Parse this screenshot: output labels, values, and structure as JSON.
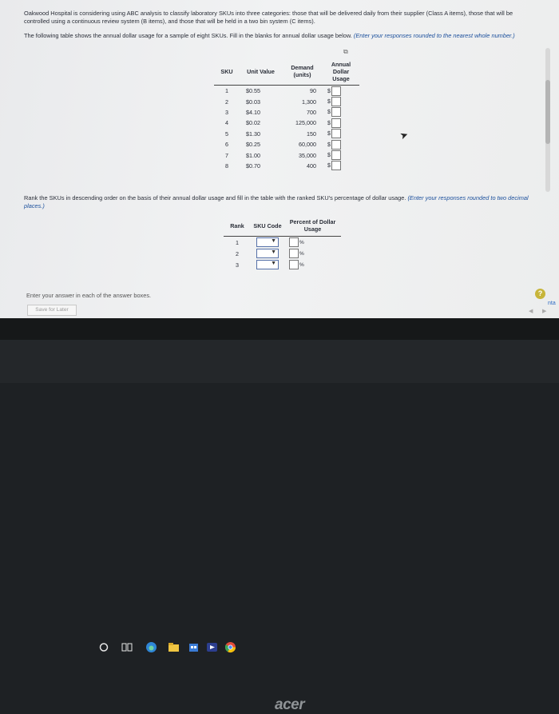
{
  "question": {
    "paragraph1": "Oakwood Hospital is considering using ABC analysis to classify laboratory SKUs into three categories: those that will be delivered daily from their supplier (Class A items), those that will be controlled using a continuous review system (B items), and those that will be held in a two bin system (C items).",
    "paragraph2_main": "The following table shows the annual dollar usage for a sample of eight SKUs. Fill in the blanks for annual dollar usage below.",
    "paragraph2_hint": "(Enter your responses rounded to the nearest whole number.)",
    "paragraph3_main": "Rank the SKUs in descending order on the basis of their annual dollar usage and fill in the table with the ranked SKU's percentage of dollar usage.",
    "paragraph3_hint": "(Enter your responses rounded to two decimal places.)"
  },
  "sku_table": {
    "headers": {
      "sku": "SKU",
      "unit_value": "Unit Value",
      "demand": "Demand (units)",
      "usage": "Annual Dollar Usage"
    },
    "currency": "$",
    "rows": [
      {
        "sku": "1",
        "unit_value": "$0.55",
        "demand": "90"
      },
      {
        "sku": "2",
        "unit_value": "$0.03",
        "demand": "1,300"
      },
      {
        "sku": "3",
        "unit_value": "$4.10",
        "demand": "700"
      },
      {
        "sku": "4",
        "unit_value": "$0.02",
        "demand": "125,000"
      },
      {
        "sku": "5",
        "unit_value": "$1.30",
        "demand": "150"
      },
      {
        "sku": "6",
        "unit_value": "$0.25",
        "demand": "60,000"
      },
      {
        "sku": "7",
        "unit_value": "$1.00",
        "demand": "35,000"
      },
      {
        "sku": "8",
        "unit_value": "$0.70",
        "demand": "400"
      }
    ]
  },
  "rank_table": {
    "headers": {
      "rank": "Rank",
      "sku_code": "SKU Code",
      "percent": "Percent of Dollar Usage"
    },
    "percent_sign": "%",
    "rows": [
      {
        "rank": "1"
      },
      {
        "rank": "2"
      },
      {
        "rank": "3"
      }
    ]
  },
  "footer": {
    "instruction": "Enter your answer in each of the answer boxes.",
    "save_label": "Save for Later",
    "help_label": "?",
    "side_link": "nta"
  },
  "device": {
    "brand": "acer"
  }
}
